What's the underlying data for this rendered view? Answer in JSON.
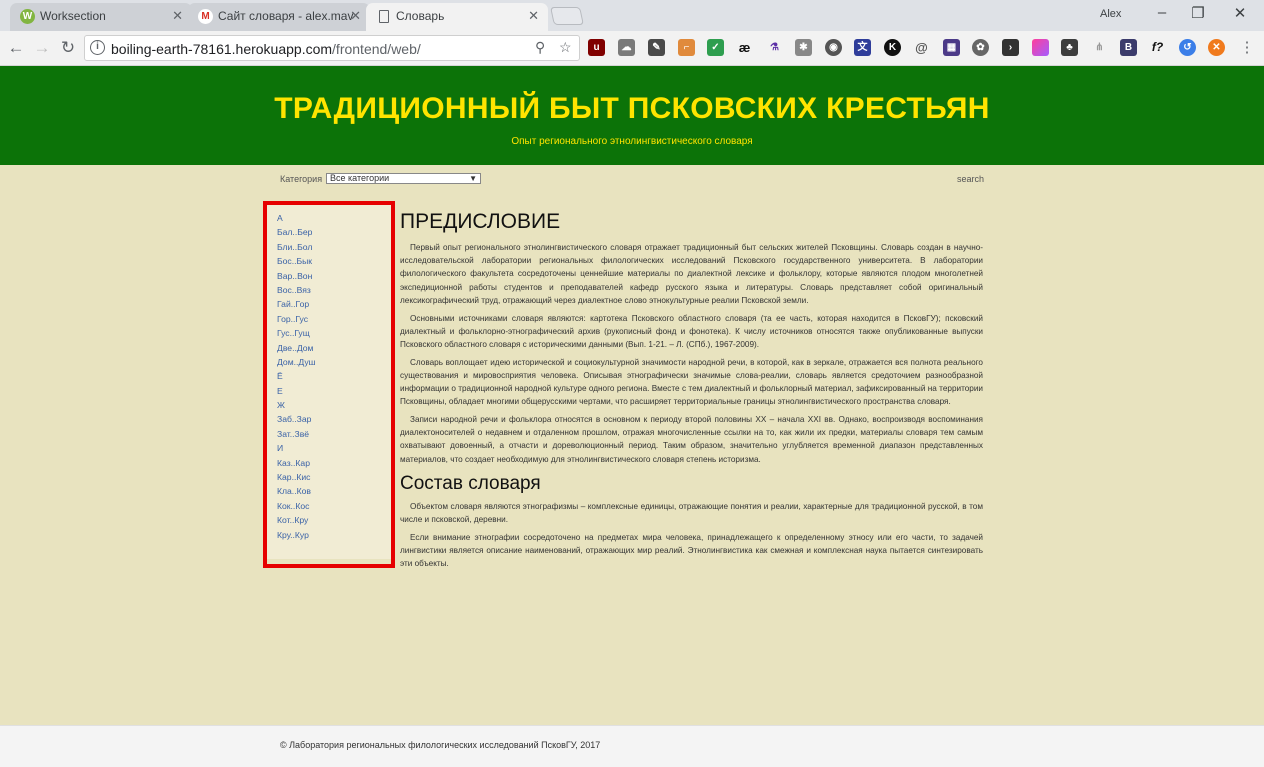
{
  "browser": {
    "tabs": [
      {
        "title": "Worksection",
        "fav": "W",
        "color": "#82b541"
      },
      {
        "title": "Сайт словаря - alex.mav",
        "fav": "M",
        "color": "#d93025"
      },
      {
        "title": "Словарь",
        "fav": "",
        "color": "#ffffff"
      }
    ],
    "profile": "Alex",
    "url_host": "boiling-earth-78161.herokuapp.com",
    "url_path": "/frontend/web/",
    "extensions": [
      "uBlock",
      "cloud",
      "pen",
      "brackets",
      "shield",
      "ae",
      "flask",
      "puzzle",
      "globe",
      "translate",
      "K",
      "at",
      "grid",
      "gear",
      "terminal",
      "gradient",
      "evernote",
      "tree",
      "B",
      "f?",
      "sync",
      "ring"
    ]
  },
  "site": {
    "title": "ТРАДИЦИОННЫЙ БЫТ ПСКОВСКИХ КРЕСТЬЯН",
    "subtitle": "Опыт регионального этнолингвистического словаря"
  },
  "filter": {
    "category_label": "Категория",
    "category_value": "Все категории",
    "search_label": "search"
  },
  "sidebar": {
    "letters": [
      "А",
      "Бал..Бер",
      "Бли..Бол",
      "Бос..Бык",
      "Вар..Вон",
      "Вос..Вяз",
      "Гай..Гор",
      "Гор..Гус",
      "Гус..Гущ",
      "Две..Дом",
      "Дом..Душ",
      "Ё",
      "Е",
      "Ж",
      "Заб..Зар",
      "Зат..Звё",
      "И",
      "Каз..Кар",
      "Кар..Кис",
      "Кла..Ков",
      "Кок..Кос",
      "Кот..Кру",
      "Кру..Кур"
    ]
  },
  "main": {
    "heading1": "ПРЕДИСЛОВИЕ",
    "p1": "Первый опыт регионального этнолингвистического словаря отражает традиционный быт сельских жителей Псковщины. Словарь создан в научно-исследовательской лаборатории региональных филологических исследований Псковского государственного университета. В лаборатории филологического факультета сосредоточены ценнейшие материалы по диалектной лексике и фольклору, которые являются плодом многолетней экспедиционной работы студентов и преподавателей кафедр русского языка и литературы. Словарь представляет собой оригинальный лексикографический труд, отражающий через диалектное слово этнокультурные реалии Псковской земли.",
    "p2": "Основными источниками словаря являются: картотека Псковского областного словаря (та ее часть, которая находится в ПсковГУ); псковский диалектный и фольклорно-этнографический архив (рукописный фонд и фонотека). К числу источников относятся также опубликованные выпуски Псковского областного словаря с историческими данными (Вып. 1-21. – Л. (СПб.), 1967-2009).",
    "p3": "Словарь воплощает идею исторической и социокультурной значимости народной речи, в которой, как в зеркале, отражается вся полнота реального существования и мировосприятия человека. Описывая этнографически значимые слова-реалии, словарь является средоточием разнообразной информации о традиционной народной культуре одного региона. Вместе с тем диалектный и фольклорный материал, зафиксированный на территории Псковщины, обладает многими общерусскими чертами, что расширяет территориальные границы этнолингвистического пространства словаря.",
    "p4": "Записи народной речи и фольклора относятся в основном к периоду второй половины XX – начала XXI вв. Однако, воспроизводя воспоминания диалектоносителей о недавнем и отдаленном прошлом, отражая многочисленные ссылки на то, как жили их предки, материалы словаря тем самым охватывают довоенный, а отчасти и дореволюционный период. Таким образом, значительно углубляется временной диапазон представленных материалов, что создает необходимую для этнолингвистического словаря степень историзма.",
    "heading2": "Состав словаря",
    "p5": "Объектом словаря являются этнографизмы – комплексные единицы, отражающие понятия и реалии, характерные для традиционной русской, в том числе и псковской, деревни.",
    "p6": "Если внимание этнографии сосредоточено на предметах мира человека, принадлежащего к определенному этносу или его части, то задачей лингвистики является описание наименований, отражающих мир реалий. Этнолингвистика как смежная и комплексная наука пытается синтезировать эти объекты."
  },
  "footer": {
    "text": "© Лаборатория региональных филологических исследований ПсковГУ, 2017"
  },
  "colors": {
    "header_bg": "#0c7308",
    "title_color": "#ffe400",
    "content_bg": "#e8e3bf",
    "sidebar_bg": "#f1ecd4",
    "highlight_border": "#e60000",
    "link_color": "#3a62a7"
  }
}
